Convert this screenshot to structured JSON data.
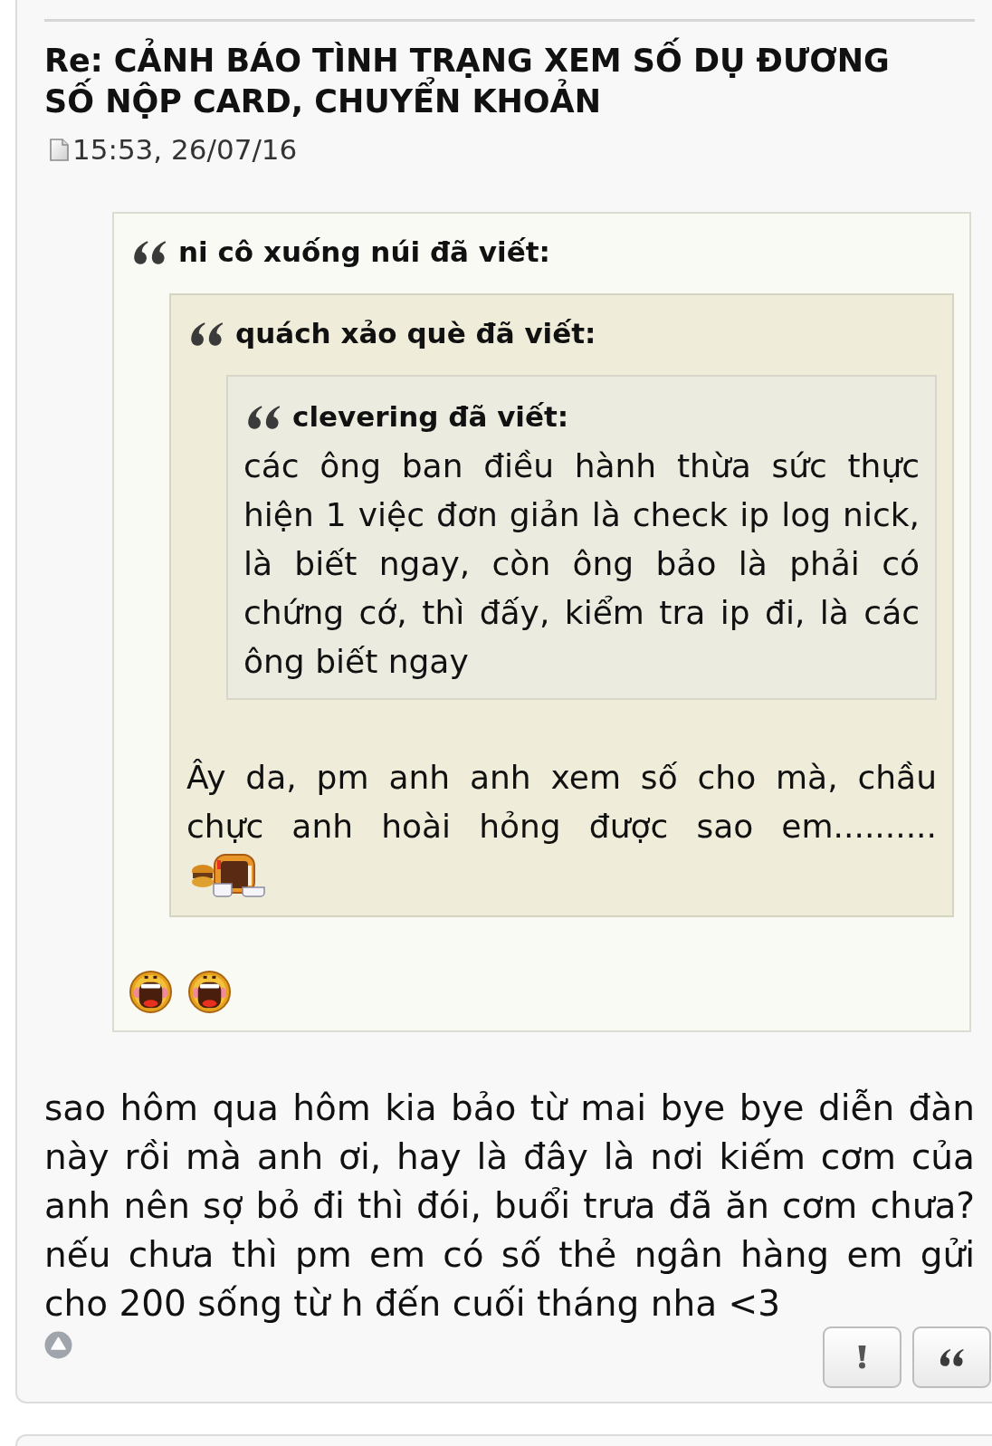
{
  "post": {
    "title": "Re: CẢNH BÁO TÌNH TRẠNG XEM SỐ DỤ ĐƯƠNG SỐ NỘP CARD, CHUYỂN KHOẢN",
    "timestamp": "15:53, 26/07/16",
    "quote": {
      "attribution": "ni cô xuống núi đã viết:",
      "quote": {
        "attribution": "quách xảo què đã viết:",
        "quote": {
          "attribution": "clevering đã viết:",
          "text": "các ông ban điều hành thừa sức thực hiện 1 việc đơn giản là check ip log nick, là biết ngay, còn ông bảo là phải có chứng cớ, thì đấy, kiểm tra ip đi, là các ông biết ngay"
        },
        "text": "Ây da, pm anh anh xem số cho mà, chầu chực anh hoài hỏng được sao em..........",
        "emoticons": [
          {
            "kind": "monitor"
          }
        ]
      },
      "emoticons": [
        {
          "kind": "laughing"
        },
        {
          "kind": "laughing"
        }
      ]
    },
    "text": "sao hôm qua hôm kia bảo từ mai bye bye diễn đàn này rồi mà anh ơi, hay là đây là nơi kiếm cơm của anh nên sợ bỏ đi thì đói, buổi trưa đã ăn cơm chưa? nếu chưa thì pm em có số thẻ ngân hàng em gửi cho 200 sống từ h đến cuối tháng nha <3",
    "buttons": [
      {
        "kind": "report"
      },
      {
        "kind": "quote"
      }
    ]
  }
}
